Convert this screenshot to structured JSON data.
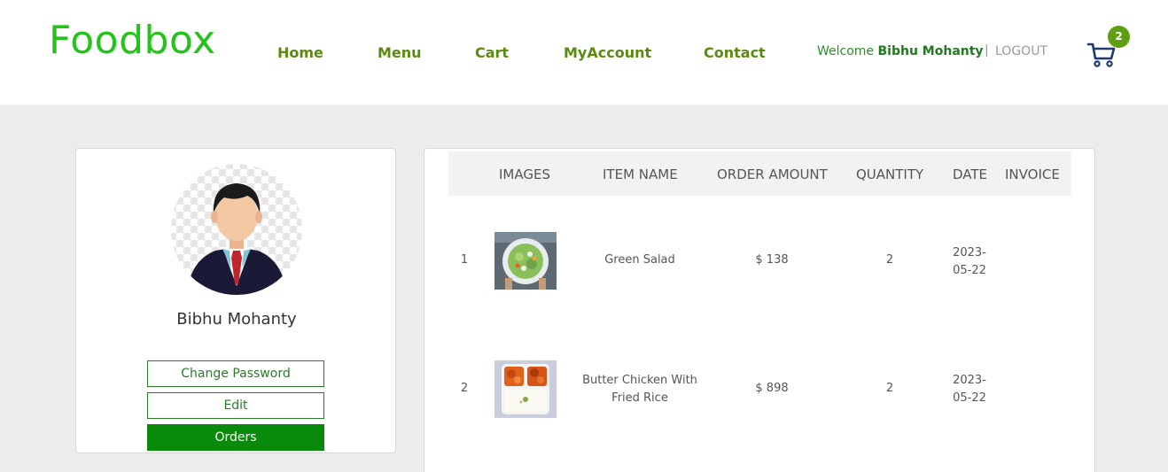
{
  "brand": {
    "logo": "Foodbox"
  },
  "nav": {
    "home": "Home",
    "menu": "Menu",
    "cart": "Cart",
    "account": "MyAccount",
    "contact": "Contact"
  },
  "user": {
    "welcome_prefix": "Welcome",
    "name": "Bibhu Mohanty",
    "separator": "|",
    "logout": "LOGOUT"
  },
  "cart": {
    "count": "2",
    "icon": "cart-icon"
  },
  "profile": {
    "name": "Bibhu Mohanty",
    "buttons": {
      "change_password": "Change Password",
      "edit": "Edit",
      "orders": "Orders"
    }
  },
  "orders": {
    "columns": {
      "images": "IMAGES",
      "item_name": "ITEM NAME",
      "order_amount": "ORDER AMOUNT",
      "quantity": "QUANTITY",
      "date": "DATE",
      "invoice": "INVOICE"
    },
    "rows": [
      {
        "index": "1",
        "item_name": "Green Salad",
        "amount": "$ 138",
        "quantity": "2",
        "date_1": "2023-",
        "date_2": "05-22"
      },
      {
        "index": "2",
        "item_name": "Butter Chicken With Fried Rice",
        "amount": "$ 898",
        "quantity": "2",
        "date_1": "2023-",
        "date_2": "05-22"
      }
    ]
  },
  "colors": {
    "brand_green": "#22c41a",
    "nav_green": "#5b8a10",
    "active_button": "#0a8a0a"
  }
}
